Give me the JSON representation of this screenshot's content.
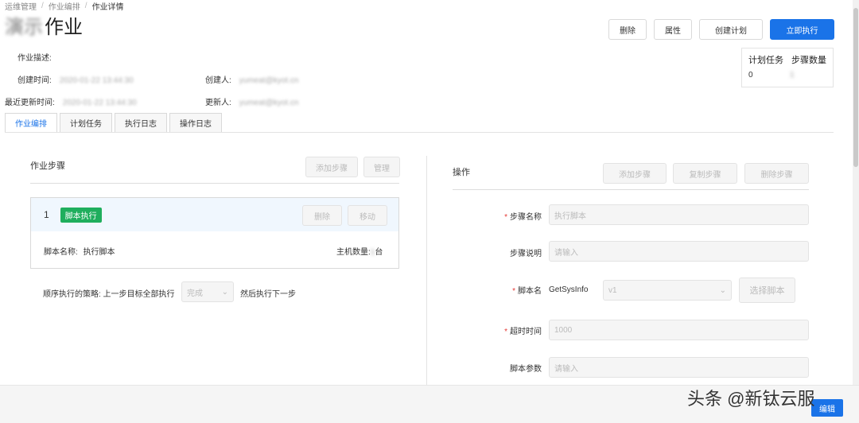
{
  "breadcrumb": [
    "运维管理",
    "作业编排",
    "作业详情"
  ],
  "title": {
    "blurred_prefix": "演示",
    "text": "作业"
  },
  "header_buttons": {
    "delete": "删除",
    "properties": "属性",
    "create_plan": "创建计划",
    "execute_now": "立即执行"
  },
  "meta": {
    "description_label": "作业描述:",
    "created_time_label": "创建时间:",
    "created_time_value": "2020-01-22 13:44:30",
    "creator_label": "创建人:",
    "creator_value": "yumeat@kyot.cn",
    "updated_time_label": "最近更新时间:",
    "updated_time_value": "2020-01-22 13:44:30",
    "updater_label": "更新人:",
    "updater_value": "yumeat@kyot.cn"
  },
  "stats": {
    "plan_tasks_label": "计划任务",
    "steps_count_label": "步骤数量",
    "plan_tasks_value": "0",
    "steps_count_value": "1"
  },
  "tabs": [
    "作业编排",
    "计划任务",
    "执行日志",
    "操作日志"
  ],
  "left_panel": {
    "title": "作业步骤",
    "add_step": "添加步骤",
    "manage": "管理",
    "step": {
      "index": "1",
      "badge": "脚本执行",
      "delete": "删除",
      "move": "移动",
      "script_name_label": "脚本名称:",
      "script_name_value": "执行脚本",
      "host_count_label": "主机数量:",
      "host_count_value": "1",
      "host_unit": "台"
    },
    "strategy_prefix": "顺序执行的策略: 上一步目标全部执行",
    "strategy_select": "完成",
    "strategy_suffix": "然后执行下一步"
  },
  "right_panel": {
    "title": "操作",
    "add_step": "添加步骤",
    "copy_step": "复制步骤",
    "delete_step": "删除步骤",
    "fields": {
      "step_name_label": "步骤名称",
      "step_name_value": "执行脚本",
      "step_desc_label": "步骤说明",
      "step_desc_placeholder": "请输入",
      "script_name_label": "脚本名",
      "script_name_value": "GetSysInfo",
      "script_version": "v1",
      "choose_script": "选择脚本",
      "timeout_label": "超时时间",
      "timeout_value": "1000",
      "script_params_label": "脚本参数",
      "script_params_placeholder": "请输入"
    }
  },
  "footer": {
    "edit": "编辑",
    "watermark": "头条 @新钛云服"
  }
}
